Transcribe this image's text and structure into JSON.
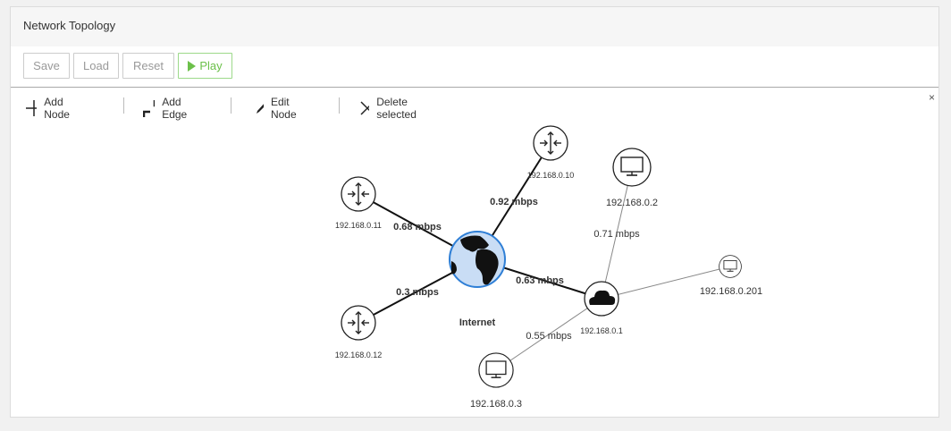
{
  "panel": {
    "title": "Network Topology"
  },
  "buttons": {
    "save": "Save",
    "load": "Load",
    "reset": "Reset",
    "play": "Play"
  },
  "toolbar": {
    "add_node": "Add Node",
    "add_edge": "Add Edge",
    "edit_node": "Edit Node",
    "delete_selected": "Delete selected",
    "close": "×"
  },
  "colors": {
    "play_green": "#6cc04a",
    "globe_blue": "#c9ddf5",
    "globe_border": "#2f7fd6"
  },
  "diagram": {
    "internet_label": "Internet",
    "nodes": {
      "router_10": "192.168.0.10",
      "router_11": "192.168.0.11",
      "router_12": "192.168.0.12",
      "cloud_1": "192.168.0.1",
      "pc_2": "192.168.0.2",
      "pc_201": "192.168.0.201",
      "pc_3": "192.168.0.3"
    },
    "edges": {
      "internet_router_10": "0.92 mbps",
      "internet_router_11": "0.68 mbps",
      "internet_router_12": "0.3 mbps",
      "internet_cloud": "0.63 mbps",
      "cloud_pc_2": "0.71 mbps",
      "cloud_pc_3": "0.55 mbps"
    }
  }
}
